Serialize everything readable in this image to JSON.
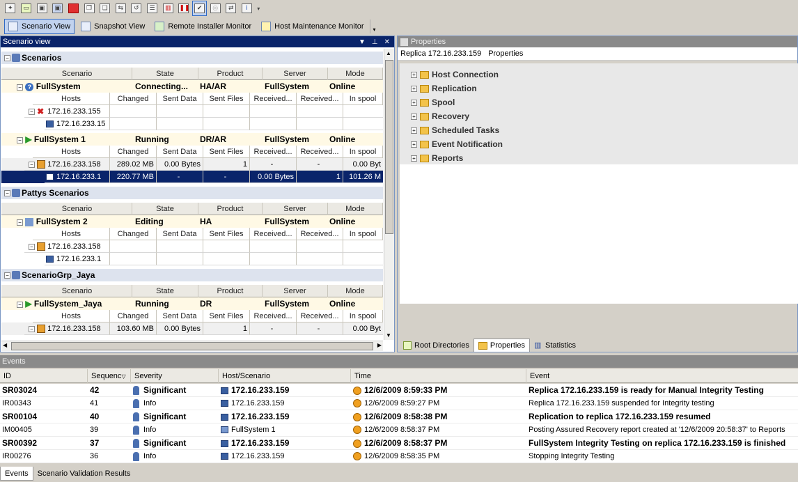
{
  "toolbar": {
    "icons": [
      "new-scenario-icon",
      "new-group-icon",
      "save-icon",
      "save-all-icon",
      "stop-icon",
      "copy-icon",
      "paste-icon",
      "sync-icon",
      "restore-icon",
      "report-icon",
      "chart-icon",
      "pause-icon",
      "integrity-icon",
      "disabled-icon",
      "switch-icon",
      "info-icon"
    ]
  },
  "viewbar": {
    "items": [
      {
        "label": "Scenario View",
        "active": true
      },
      {
        "label": "Snapshot View",
        "active": false
      },
      {
        "label": "Remote Installer Monitor",
        "active": false
      },
      {
        "label": "Host Maintenance Monitor",
        "active": false
      }
    ]
  },
  "scenario_panel": {
    "title": "Scenario view",
    "headers": [
      "Scenario",
      "State",
      "Product",
      "Server",
      "Mode"
    ],
    "subheaders": [
      "Hosts",
      "Changed",
      "Sent Data",
      "Sent Files",
      "Received...",
      "Received...",
      "In spool"
    ],
    "groups": [
      {
        "name": "Scenarios"
      },
      {
        "name": "Pattys Scenarios"
      },
      {
        "name": "ScenarioGrp_Jaya"
      }
    ],
    "scenarios": [
      {
        "name": "FullSystem",
        "state": "Connecting...",
        "product": "HA/AR",
        "server": "FullSystem",
        "mode": "Online"
      },
      {
        "name": "FullSystem 1",
        "state": "Running",
        "product": "DR/AR",
        "server": "FullSystem",
        "mode": "Online"
      },
      {
        "name": "FullSystem 2",
        "state": "Editing",
        "product": "HA",
        "server": "FullSystem",
        "mode": "Online"
      },
      {
        "name": "FullSystem_Jaya",
        "state": "Running",
        "product": "DR",
        "server": "FullSystem",
        "mode": "Online"
      }
    ],
    "hosts": {
      "fs_master": "172.16.233.155",
      "fs_replica": "172.16.233.15",
      "fs1_master": {
        "host": "172.16.233.158",
        "changed": "289.02 MB",
        "sent": "0.00 Bytes",
        "files": "1",
        "r1": "-",
        "r2": "-",
        "spool": "0.00 Byt"
      },
      "fs1_replica": {
        "host": "172.16.233.1",
        "changed": "220.77 MB",
        "sent": "-",
        "files": "-",
        "r1": "0.00 Bytes",
        "r2": "1",
        "spool": "101.26 M"
      },
      "fs2_master": "172.16.233.158",
      "fs2_replica": "172.16.233.1",
      "jaya_master": {
        "host": "172.16.233.158",
        "changed": "103.60 MB",
        "sent": "0.00 Bytes",
        "files": "1",
        "r1": "-",
        "r2": "-",
        "spool": "0.00 Byt"
      }
    }
  },
  "properties_panel": {
    "title": "Properties",
    "subtitle_host": "Replica 172.16.233.159",
    "subtitle_label": "Properties",
    "items": [
      "Host Connection",
      "Replication",
      "Spool",
      "Recovery",
      "Scheduled Tasks",
      "Event Notification",
      "Reports"
    ],
    "tabs": [
      {
        "label": "Root Directories",
        "active": false
      },
      {
        "label": "Properties",
        "active": true
      },
      {
        "label": "Statistics",
        "active": false
      }
    ]
  },
  "events_panel": {
    "title": "Events",
    "columns": [
      "ID",
      "Sequenc",
      "Severity",
      "Host/Scenario",
      "Time",
      "Event"
    ],
    "rows": [
      {
        "id": "SR03024",
        "seq": "42",
        "sev": "Significant",
        "host": "172.16.233.159",
        "time": "12/6/2009 8:59:33 PM",
        "event": "Replica  172.16.233.159  is ready for Manual Integrity Testing",
        "bold": true,
        "host_icon": "monitor"
      },
      {
        "id": "IR00343",
        "seq": "41",
        "sev": "Info",
        "host": "172.16.233.159",
        "time": "12/6/2009 8:59:27 PM",
        "event": "Replica  172.16.233.159  suspended for Integrity testing",
        "bold": false,
        "host_icon": "monitor"
      },
      {
        "id": "SR00104",
        "seq": "40",
        "sev": "Significant",
        "host": "172.16.233.159",
        "time": "12/6/2009 8:58:38 PM",
        "event": "Replication to replica  172.16.233.159   resumed",
        "bold": true,
        "host_icon": "monitor"
      },
      {
        "id": "IM00405",
        "seq": "39",
        "sev": "Info",
        "host": "FullSystem 1",
        "time": "12/6/2009 8:58:37 PM",
        "event": "Posting Assured Recovery report created at '12/6/2009 20:58:37' to Reports",
        "bold": false,
        "host_icon": "scenario"
      },
      {
        "id": "SR00392",
        "seq": "37",
        "sev": "Significant",
        "host": "172.16.233.159",
        "time": "12/6/2009 8:58:37 PM",
        "event": "FullSystem Integrity Testing on replica 172.16.233.159 is finished",
        "bold": true,
        "host_icon": "monitor"
      },
      {
        "id": "IR00276",
        "seq": "36",
        "sev": "Info",
        "host": "172.16.233.159",
        "time": "12/6/2009 8:58:35 PM",
        "event": "Stopping  Integrity Testing",
        "bold": false,
        "host_icon": "monitor"
      }
    ],
    "tabs": [
      {
        "label": "Events",
        "active": true
      },
      {
        "label": "Scenario Validation Results",
        "active": false
      }
    ]
  }
}
